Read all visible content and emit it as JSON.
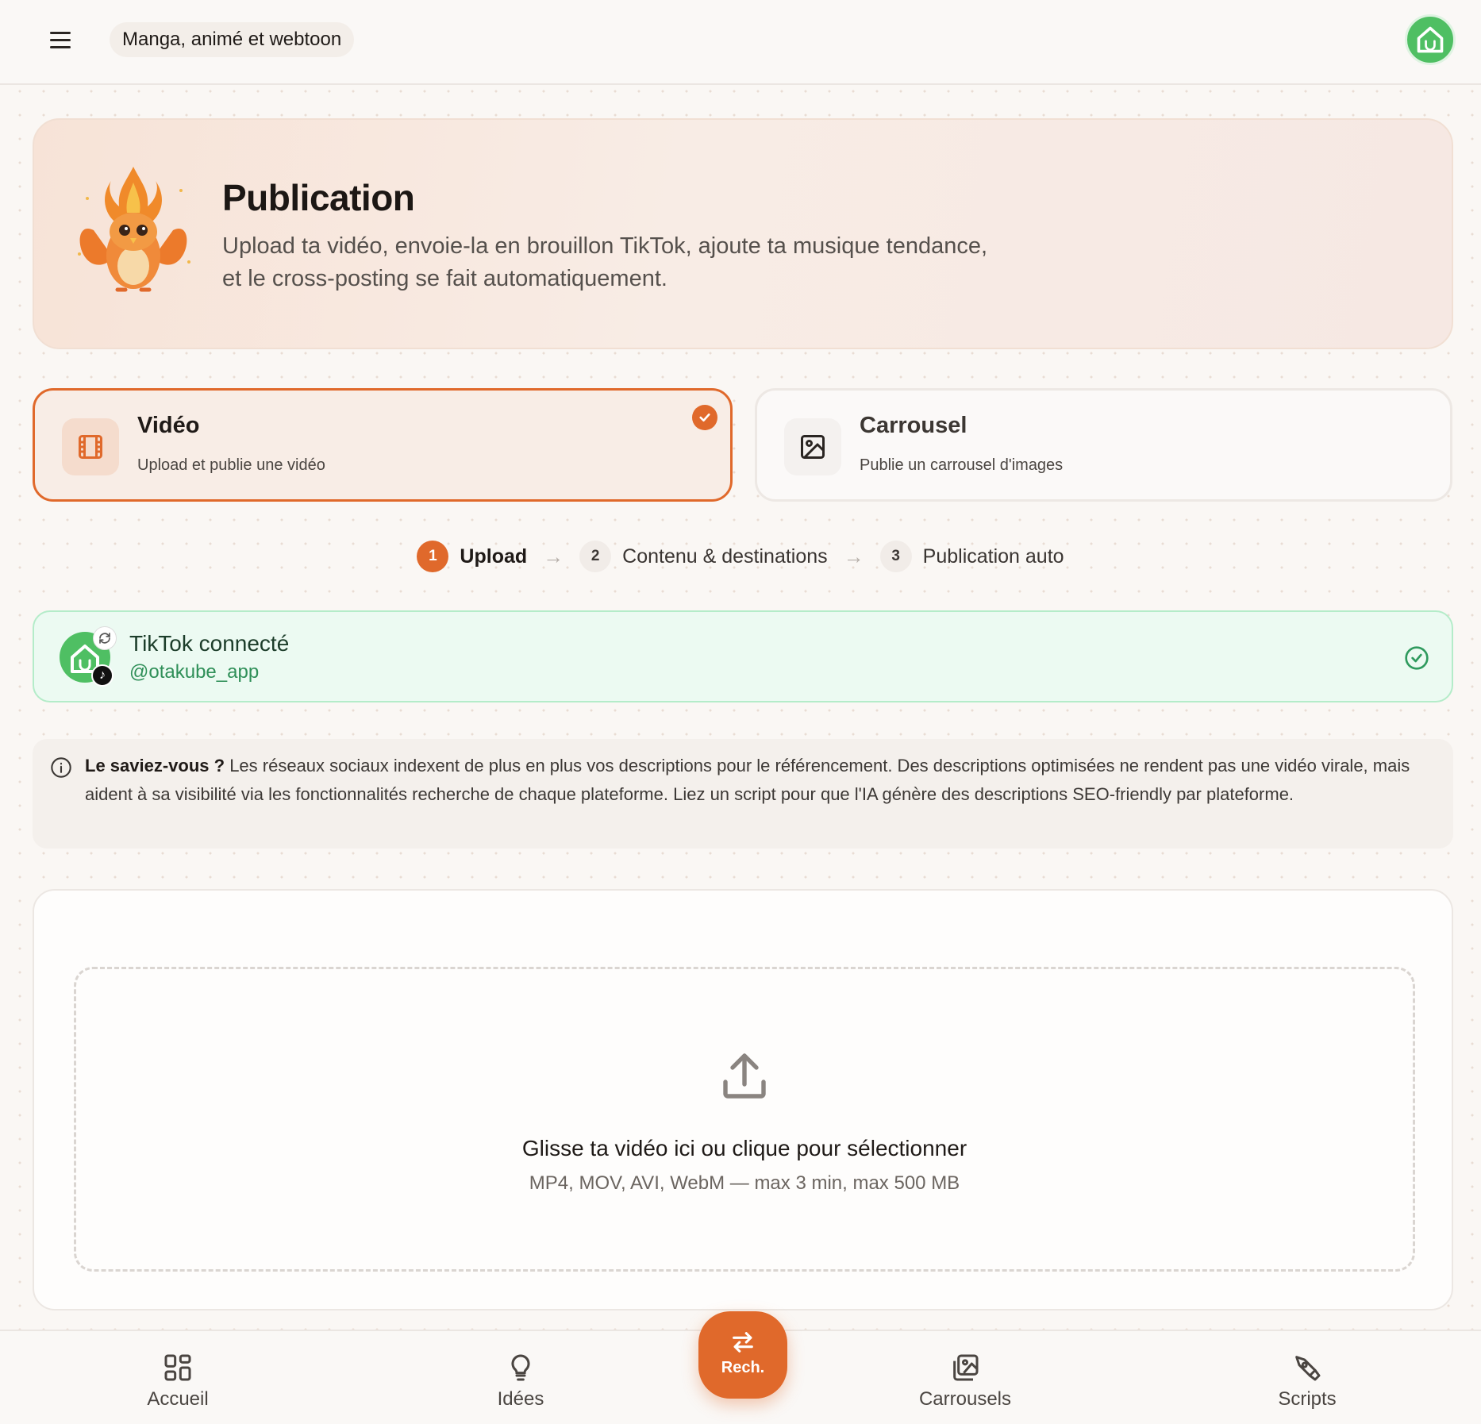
{
  "topbar": {
    "category": "Manga, animé et webtoon"
  },
  "hero": {
    "title": "Publication",
    "description_line1": "Upload ta vidéo, envoie-la en brouillon TikTok, ajoute ta musique tendance,",
    "description_line2": "et le cross-posting se fait automatiquement."
  },
  "types": [
    {
      "title": "Vidéo",
      "subtitle": "Upload et publie une vidéo",
      "selected": true,
      "icon": "film-icon"
    },
    {
      "title": "Carrousel",
      "subtitle": "Publie un carrousel d'images",
      "selected": false,
      "icon": "image-icon"
    }
  ],
  "stepper": [
    {
      "num": "1",
      "label": "Upload",
      "active": true
    },
    {
      "num": "2",
      "label": "Contenu & destinations",
      "active": false
    },
    {
      "num": "3",
      "label": "Publication auto",
      "active": false
    }
  ],
  "tiktok": {
    "title": "TikTok connecté",
    "handle": "@otakube_app"
  },
  "info": {
    "lead": "Le saviez-vous ?",
    "text": " Les réseaux sociaux indexent de plus en plus vos descriptions pour le référencement. Des descriptions optimisées ne rendent pas une vidéo virale, mais aident à sa visibilité via les fonctionnalités recherche de chaque plateforme. Liez un script pour que l'IA génère des descriptions SEO-friendly par plateforme."
  },
  "upload": {
    "title": "Glisse ta vidéo ici ou clique pour sélectionner",
    "subtitle": "MP4, MOV, AVI, WebM — max 3 min, max 500 MB"
  },
  "bottom_nav": {
    "home": "Accueil",
    "ideas": "Idées",
    "search": "Rech.",
    "carousels": "Carrousels",
    "scripts": "Scripts"
  },
  "colors": {
    "accent": "#e0692b",
    "success": "#2f8f58",
    "brand_green": "#4fbf63"
  }
}
